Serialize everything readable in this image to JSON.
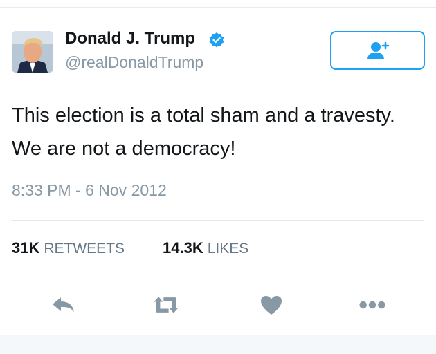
{
  "tweet": {
    "author_name": "Donald J. Trump",
    "author_handle": "@realDonaldTrump",
    "verified": true,
    "text_line1": "This election is a total sham and a travesty.",
    "text_line2": "We are not a democracy!",
    "timestamp": "8:33 PM - 6 Nov 2012",
    "retweets": {
      "count": "31K",
      "label": "RETWEETS"
    },
    "likes": {
      "count": "14.3K",
      "label": "LIKES"
    }
  },
  "icons": {
    "follow": "add-user-icon",
    "verified": "verified-badge-icon",
    "reply": "reply-icon",
    "retweet": "retweet-icon",
    "like": "heart-icon",
    "more": "more-icon"
  },
  "colors": {
    "accent": "#1da1f2",
    "text_primary": "#14171a",
    "text_secondary": "#8899a6",
    "icon_gray": "#8899a6"
  }
}
